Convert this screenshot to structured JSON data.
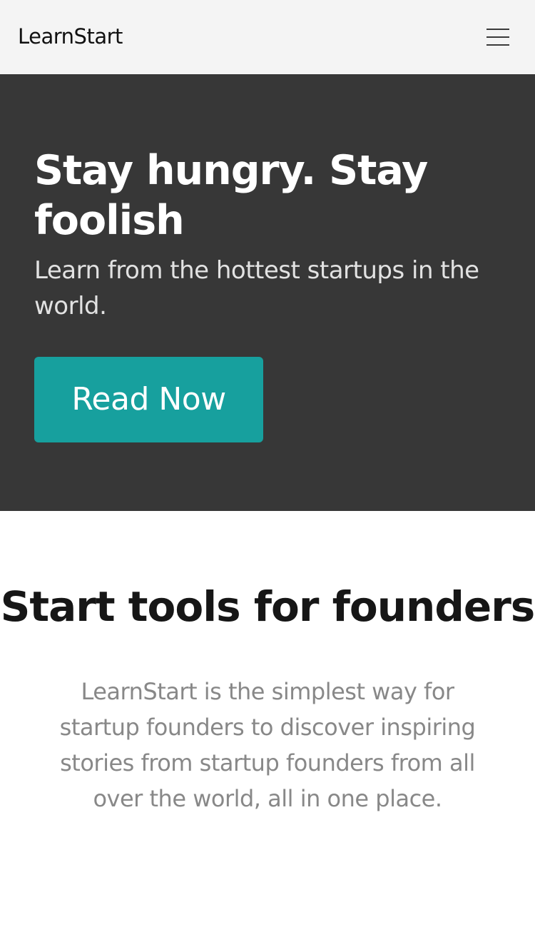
{
  "navbar": {
    "brand": "LearnStart",
    "menu_icon": "hamburger-menu-icon"
  },
  "hero": {
    "title": "Stay hungry. Stay foolish",
    "subtitle": "Learn from the hottest startups in the world.",
    "cta_label": "Read Now"
  },
  "features": {
    "title": "Start tools for founders",
    "description": "LearnStart is the simplest way for startup founders to discover inspiring stories from startup founders from all over the world, all in one place."
  },
  "colors": {
    "navbar_bg": "#f4f4f4",
    "hero_bg": "#373737",
    "accent": "#17a09e",
    "body_text": "#888888"
  }
}
